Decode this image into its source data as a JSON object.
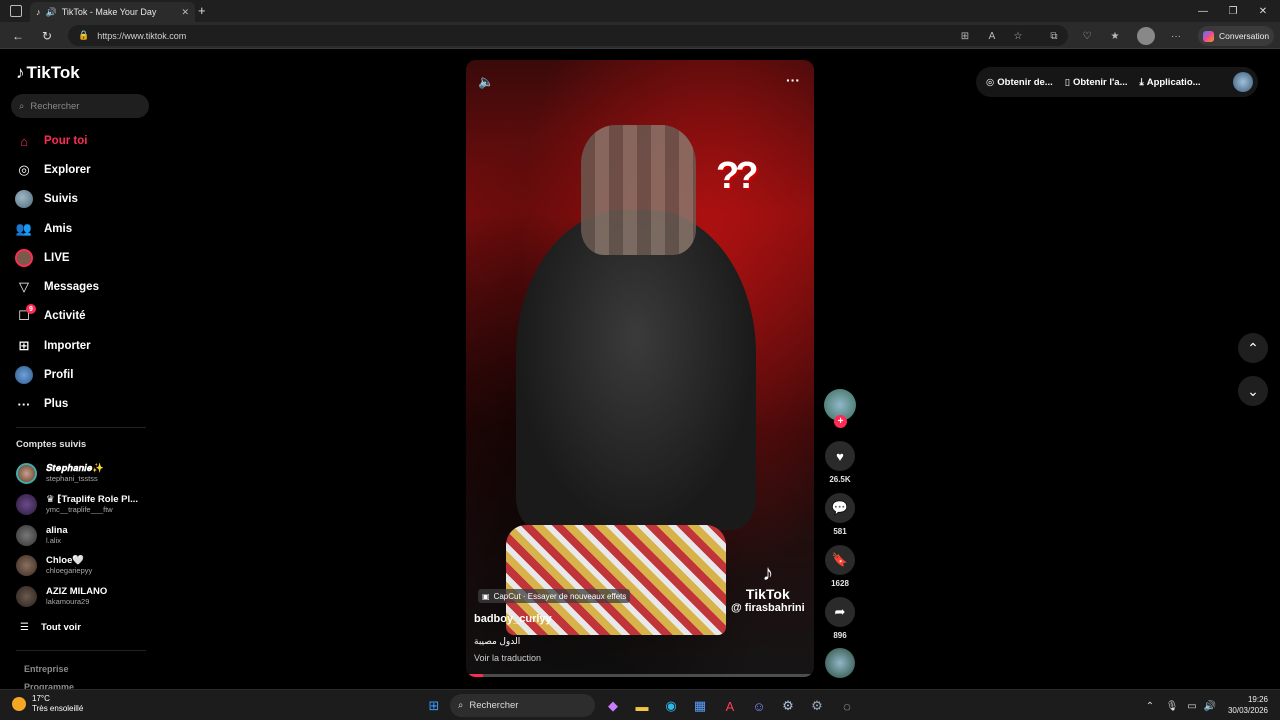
{
  "browser": {
    "tab_title": "TikTok - Make Your Day",
    "url": "https://www.tiktok.com",
    "conversation_label": "Conversation"
  },
  "sidebar": {
    "brand": "TikTok",
    "search_placeholder": "Rechercher",
    "nav": [
      {
        "label": "Pour toi",
        "icon": "home-icon",
        "active": true
      },
      {
        "label": "Explorer",
        "icon": "compass-icon"
      },
      {
        "label": "Suivis",
        "icon": "avatar-icon"
      },
      {
        "label": "Amis",
        "icon": "friends-icon"
      },
      {
        "label": "LIVE",
        "icon": "live-avatar-icon"
      },
      {
        "label": "Messages",
        "icon": "send-icon"
      },
      {
        "label": "Activité",
        "icon": "inbox-icon",
        "badge": "9"
      },
      {
        "label": "Importer",
        "icon": "upload-icon"
      },
      {
        "label": "Profil",
        "icon": "profile-avatar-icon"
      },
      {
        "label": "Plus",
        "icon": "more-icon"
      }
    ],
    "following_title": "Comptes suivis",
    "following": [
      {
        "name": "𝑺𝒕𝒆𝒑𝒉𝒂𝒏𝒊𝒆✨",
        "user": "stephani_tsstss"
      },
      {
        "name": "♛ ⁅Traplife Role Pl...",
        "user": "ymc__traplife___ftw"
      },
      {
        "name": "alina",
        "user": "l.alix"
      },
      {
        "name": "Chloe🤍",
        "user": "chloegariepyy"
      },
      {
        "name": "AZIZ MILANO",
        "user": "lakamoura29"
      }
    ],
    "see_all": "Tout voir",
    "footer": [
      "Entreprise",
      "Programme"
    ]
  },
  "video": {
    "capcut": "CapCut · Essayer de nouveaux effets",
    "author": "badboy_curlyy",
    "description": "الدول مصيبة",
    "translate": "Voir la traduction",
    "watermark_brand": "TikTok",
    "watermark_handle": "@ firasbahrini",
    "progress": 0.05
  },
  "actions": {
    "likes": "26.5K",
    "comments": "581",
    "saves": "1628",
    "shares": "896"
  },
  "topbar": {
    "item1": "Obtenir de...",
    "item2": "Obtenir l'a...",
    "item3": "Applicatio..."
  },
  "taskbar": {
    "weather_temp": "17°C",
    "weather_desc": "Très ensoleillé",
    "search": "Rechercher",
    "time": "19:26",
    "date": "30/03/2026"
  },
  "colors": {
    "accent": "#fe2c55",
    "background": "#000000"
  }
}
